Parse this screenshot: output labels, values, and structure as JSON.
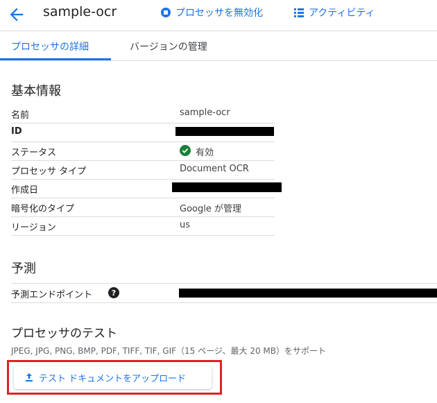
{
  "header": {
    "title": "sample-ocr",
    "disable_label": "プロセッサを無効化",
    "activity_label": "アクティビティ"
  },
  "tabs": [
    {
      "label": "プロセッサの詳細",
      "active": true
    },
    {
      "label": "バージョンの管理",
      "active": false
    }
  ],
  "basic_info": {
    "heading": "基本情報",
    "rows": [
      {
        "key": "名前",
        "value": "sample-ocr"
      },
      {
        "key": "ID",
        "value": ""
      },
      {
        "key": "ステータス",
        "value": "有効"
      },
      {
        "key": "プロセッサ タイプ",
        "value": "Document OCR"
      },
      {
        "key": "作成日",
        "value": ""
      },
      {
        "key": "暗号化のタイプ",
        "value": "Google が管理"
      },
      {
        "key": "リージョン",
        "value": "us"
      }
    ]
  },
  "prediction": {
    "heading": "予測",
    "endpoint_label": "予測エンドポイント"
  },
  "test": {
    "heading": "プロセッサのテスト",
    "supported_formats": "JPEG, JPG, PNG, BMP, PDF, TIFF, TIF, GIF（15 ページ、最大 20 MB）をサポート",
    "upload_label": "テスト ドキュメントをアップロード"
  },
  "colors": {
    "accent": "#1a73e8",
    "status_ok": "#188038",
    "highlight_box": "#e0202a"
  }
}
